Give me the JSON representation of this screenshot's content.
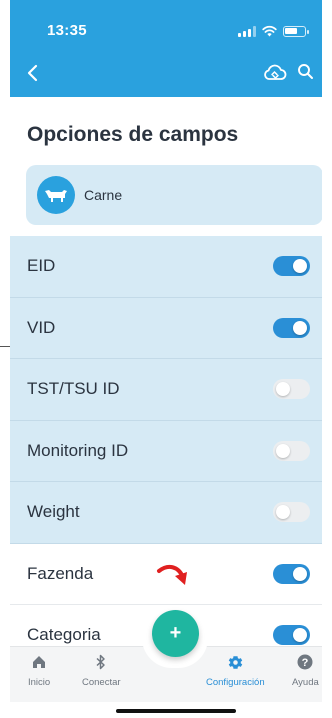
{
  "status_bar": {
    "time": "13:35"
  },
  "header": {
    "back_icon": "chevron-left-icon",
    "cloud_icon": "cloud-sync-icon",
    "search_icon": "search-icon"
  },
  "page": {
    "title": "Opciones de campos"
  },
  "species": {
    "label": "Carne",
    "icon": "cow-icon"
  },
  "fields": [
    {
      "label": "EID",
      "enabled": true,
      "highlighted": true
    },
    {
      "label": "VID",
      "enabled": true,
      "highlighted": true
    },
    {
      "label": "TST/TSU ID",
      "enabled": false,
      "highlighted": true
    },
    {
      "label": "Monitoring ID",
      "enabled": false,
      "highlighted": true
    },
    {
      "label": "Weight",
      "enabled": false,
      "highlighted": true
    },
    {
      "label": "Fazenda",
      "enabled": true,
      "highlighted": false
    },
    {
      "label": "Categoria",
      "enabled": true,
      "highlighted": false
    }
  ],
  "fab": {
    "label": "+"
  },
  "bottom_nav": [
    {
      "label": "Inicio",
      "icon": "home-icon",
      "active": false
    },
    {
      "label": "Conectar",
      "icon": "bluetooth-icon",
      "active": false
    },
    {
      "label": "Configuración",
      "icon": "gear-icon",
      "active": true
    },
    {
      "label": "Ayuda",
      "icon": "help-icon",
      "active": false
    }
  ],
  "colors": {
    "primary": "#2aa1de",
    "toggle_on": "#2a8fd6",
    "highlight_bg": "#d6eaf5",
    "fab": "#1fb6a0",
    "annotation_arrow": "#e02020"
  }
}
